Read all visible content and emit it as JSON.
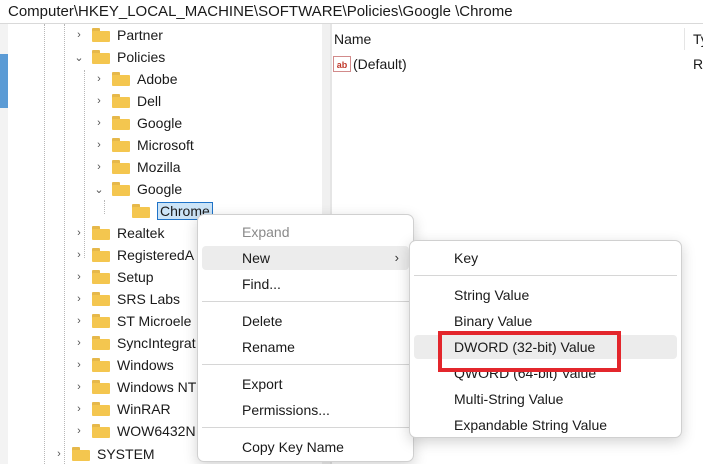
{
  "address": "Computer\\HKEY_LOCAL_MACHINE\\SOFTWARE\\Policies\\Google \\Chrome",
  "tree": {
    "nodes": [
      {
        "label": "Partner",
        "chevron": ">"
      },
      {
        "label": "Policies",
        "chevron": "v"
      },
      {
        "label": "Adobe",
        "chevron": ">"
      },
      {
        "label": "Dell",
        "chevron": ">"
      },
      {
        "label": "Google",
        "chevron": ">"
      },
      {
        "label": "Microsoft",
        "chevron": ">"
      },
      {
        "label": "Mozilla",
        "chevron": ">"
      },
      {
        "label": "Google",
        "chevron": "v"
      },
      {
        "label": "Chrome",
        "chevron": ""
      },
      {
        "label": "Realtek",
        "chevron": ">"
      },
      {
        "label": "RegisteredA",
        "chevron": ">"
      },
      {
        "label": "Setup",
        "chevron": ">"
      },
      {
        "label": "SRS Labs",
        "chevron": ">"
      },
      {
        "label": "ST Microele",
        "chevron": ">"
      },
      {
        "label": "SyncIntegrat",
        "chevron": ">"
      },
      {
        "label": "Windows",
        "chevron": ">"
      },
      {
        "label": "Windows NT",
        "chevron": ">"
      },
      {
        "label": "WinRAR",
        "chevron": ">"
      },
      {
        "label": "WOW6432N",
        "chevron": ">"
      },
      {
        "label": "SYSTEM",
        "chevron": ">"
      }
    ]
  },
  "list": {
    "columns": {
      "name": "Name",
      "type": "Ty"
    },
    "rows": [
      {
        "name": "(Default)",
        "type": "R",
        "icon": "ab"
      }
    ]
  },
  "context_menu": {
    "items": {
      "expand": "Expand",
      "new": "New",
      "find": "Find...",
      "delete": "Delete",
      "rename": "Rename",
      "export": "Export",
      "permissions": "Permissions...",
      "copy_key_name": "Copy Key Name"
    },
    "submenu_arrow": ">"
  },
  "new_submenu": {
    "items": {
      "key": "Key",
      "string": "String Value",
      "binary": "Binary Value",
      "dword": "DWORD (32-bit) Value",
      "qword": "QWORD (64-bit) Value",
      "multi": "Multi-String Value",
      "expandable": "Expandable String Value"
    }
  },
  "colors": {
    "highlight": "#e3262c",
    "folder": "#f4c64f",
    "selection": "#cce4f7"
  }
}
